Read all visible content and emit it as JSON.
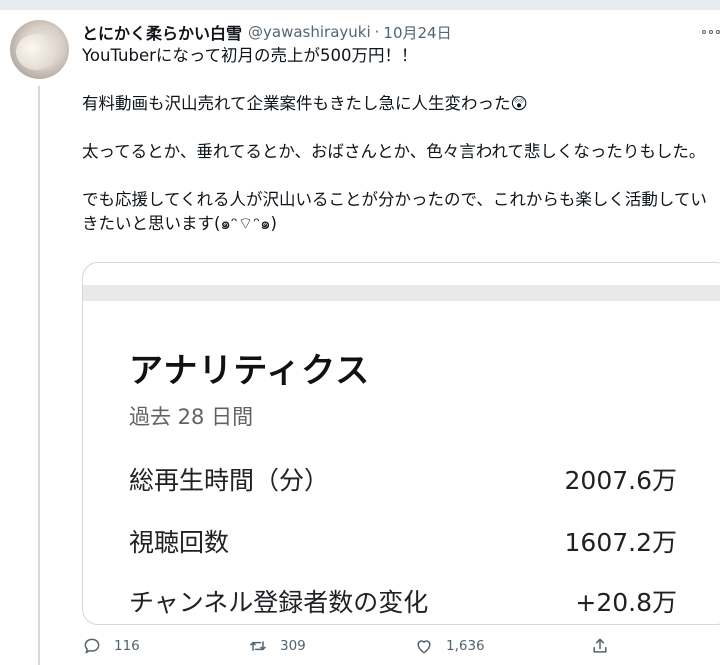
{
  "user": {
    "display_name": "とにかく柔らかい白雪",
    "handle": "@yawashirayuki",
    "separator": "·",
    "date": "10月24日"
  },
  "tweet": {
    "text": "YouTuberになって初月の売上が500万円！！\n\n有料動画も沢山売れて企業案件もきたし急に人生変わった😲\n\n太ってるとか、垂れてるとか、おばさんとか、色々言われて悲しくなったりもした。\n\nでも応援してくれる人が沢山いることが分かったので、これからも楽しく活動していきたいと思います(๑ᵔ⌔ᵔ๑)"
  },
  "media": {
    "title": "アナリティクス",
    "period": "過去 28 日間",
    "metrics": [
      {
        "label": "総再生時間（分）",
        "value": "2007.6万"
      },
      {
        "label": "視聴回数",
        "value": "1607.2万"
      },
      {
        "label": "チャンネル登録者数の変化",
        "value": "+20.8万"
      }
    ]
  },
  "actions": {
    "reply_count": "116",
    "retweet_count": "309",
    "like_count": "1,636",
    "icons": [
      "reply-icon",
      "retweet-icon",
      "like-icon",
      "share-icon"
    ]
  },
  "colors": {
    "secondary_text": "#536471",
    "border": "#cfd9de",
    "background_strip": "#e6ecf0"
  }
}
